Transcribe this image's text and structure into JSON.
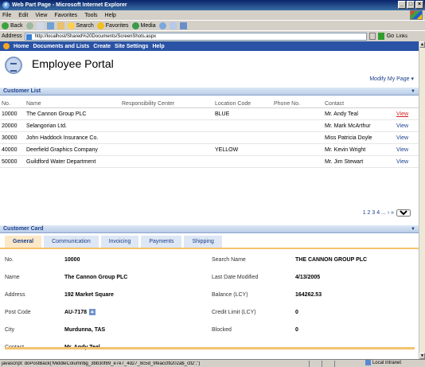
{
  "window": {
    "title": "Web Part Page - Microsoft Internet Explorer",
    "controls": [
      "_",
      "□",
      "×"
    ]
  },
  "menubar": [
    "File",
    "Edit",
    "View",
    "Favorites",
    "Tools",
    "Help"
  ],
  "toolbar": {
    "back": "Back",
    "search": "Search",
    "favorites": "Favorites",
    "media": "Media"
  },
  "address": {
    "label": "Address",
    "url": "http://localhost/Shared%20Documents/ScreenShots.aspx",
    "go": "Go",
    "links": "Links"
  },
  "nav": {
    "items": [
      "Home",
      "Documents and Lists",
      "Create",
      "Site Settings",
      "Help"
    ]
  },
  "portal": {
    "title": "Employee Portal",
    "modify": "Modify My Page ▾"
  },
  "customer_list": {
    "title": "Customer List",
    "columns": [
      "No.",
      "Name",
      "Responsibility Center",
      "Location Code",
      "Phone No.",
      "Contact"
    ],
    "rows": [
      {
        "no": "10000",
        "name": "The Cannon Group PLC",
        "resp": "",
        "loc": "BLUE",
        "phone": "",
        "contact": "Mr. Andy Teal",
        "view": "View"
      },
      {
        "no": "20000",
        "name": "Selangorian Ltd.",
        "resp": "",
        "loc": "",
        "phone": "",
        "contact": "Mr. Mark McArthur",
        "view": "View"
      },
      {
        "no": "30000",
        "name": "John Haddock Insurance Co.",
        "resp": "",
        "loc": "",
        "phone": "",
        "contact": "Miss Patricia Doyle",
        "view": "View"
      },
      {
        "no": "40000",
        "name": "Deerfield Graphics Company",
        "resp": "",
        "loc": "YELLOW",
        "phone": "",
        "contact": "Mr. Kevin Wright",
        "view": "View"
      },
      {
        "no": "50000",
        "name": "Guildford Water Department",
        "resp": "",
        "loc": "",
        "phone": "",
        "contact": "Mr. Jim Stewart",
        "view": "View"
      }
    ],
    "pager": {
      "pages": "1 2 3 4 ... › »",
      "selected": "1"
    }
  },
  "customer_card": {
    "title": "Customer Card",
    "tabs": [
      "General",
      "Communication",
      "Invoicing",
      "Payments",
      "Shipping"
    ],
    "fields": [
      {
        "l1": "No.",
        "v1": "10000",
        "l2": "Search Name",
        "v2": "THE CANNON GROUP PLC"
      },
      {
        "l1": "Name",
        "v1": "The Cannon Group PLC",
        "l2": "Last Date Modified",
        "v2": "4/13/2005"
      },
      {
        "l1": "Address",
        "v1": "192 Market Square",
        "l2": "Balance (LCY)",
        "v2": "164262.53"
      },
      {
        "l1": "Post Code",
        "v1": "AU-7178",
        "l2": "Credit Limit (LCY)",
        "v2": "0"
      },
      {
        "l1": "City",
        "v1": "Murdunna, TAS",
        "l2": "Blocked",
        "v2": "0"
      },
      {
        "l1": "Contact",
        "v1": "Mr. Andy Teal",
        "l2": "",
        "v2": ""
      }
    ]
  },
  "status": {
    "text": "javascript: doPostBack('MiddleColumn$g_3bb30f89_e7e7_4d27_8c5d_9feaccfb202a$_ctl2','')",
    "zone": "Local intranet"
  }
}
